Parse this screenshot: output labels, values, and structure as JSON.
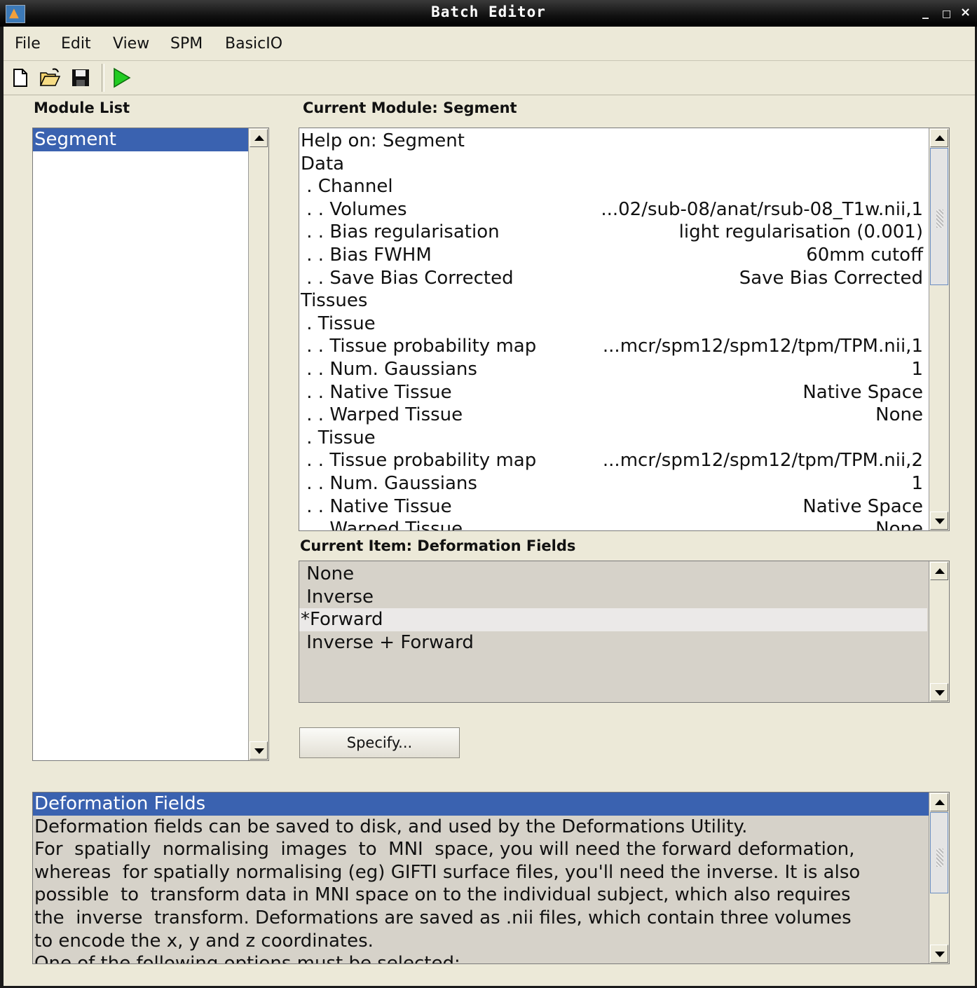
{
  "window": {
    "title": "Batch Editor",
    "controls": [
      "_",
      "□",
      "×"
    ]
  },
  "menubar": {
    "items": [
      "File",
      "Edit",
      "View",
      "SPM",
      "BasicIO"
    ]
  },
  "toolbar": {
    "buttons": [
      "new-file-icon",
      "open-folder-icon",
      "save-icon",
      "run-icon"
    ]
  },
  "module_list": {
    "label": "Module List",
    "items": [
      "Segment"
    ],
    "selected_index": 0
  },
  "current_module": {
    "label": "Current Module: Segment",
    "rows": [
      {
        "label": "Help on: Segment",
        "value": ""
      },
      {
        "label": "Data",
        "value": ""
      },
      {
        "label": " . Channel",
        "value": ""
      },
      {
        "label": " . . Volumes",
        "value": "...02/sub-08/anat/rsub-08_T1w.nii,1"
      },
      {
        "label": " . . Bias regularisation",
        "value": "light regularisation (0.001)"
      },
      {
        "label": " . . Bias FWHM",
        "value": "60mm cutoff"
      },
      {
        "label": " . . Save Bias Corrected",
        "value": "Save Bias Corrected"
      },
      {
        "label": "Tissues",
        "value": ""
      },
      {
        "label": " . Tissue",
        "value": ""
      },
      {
        "label": " . . Tissue probability map",
        "value": "...mcr/spm12/spm12/tpm/TPM.nii,1"
      },
      {
        "label": " . . Num. Gaussians",
        "value": "1"
      },
      {
        "label": " . . Native Tissue",
        "value": "Native Space"
      },
      {
        "label": " . . Warped Tissue",
        "value": "None"
      },
      {
        "label": " . Tissue",
        "value": ""
      },
      {
        "label": " . . Tissue probability map",
        "value": "...mcr/spm12/spm12/tpm/TPM.nii,2"
      },
      {
        "label": " . . Num. Gaussians",
        "value": "1"
      },
      {
        "label": " . . Native Tissue",
        "value": "Native Space"
      },
      {
        "label": " . . Warped Tissue",
        "value": "None"
      }
    ]
  },
  "current_item": {
    "label": "Current Item: Deformation Fields",
    "options": [
      " None",
      " Inverse",
      "*Forward",
      " Inverse + Forward"
    ],
    "selected_index": 2
  },
  "specify_button": {
    "label": "Specify..."
  },
  "help_panel": {
    "title": "Deformation Fields",
    "lines": [
      "Deformation fields can be saved to disk, and used by the Deformations Utility.",
      "For  spatially  normalising  images  to  MNI  space, you will need the forward deformation,",
      "whereas  for spatially normalising (eg) GIFTI surface files, you'll need the inverse. It is also",
      "possible  to  transform data in MNI space on to the individual subject, which also requires",
      "the  inverse  transform. Deformations are saved as .nii files, which contain three volumes",
      "to encode the x, y and z coordinates.",
      "One of the following options must be selected:"
    ]
  },
  "colors": {
    "selection": "#3a62b0",
    "background": "#ece9d8",
    "run": "#22cc22"
  }
}
